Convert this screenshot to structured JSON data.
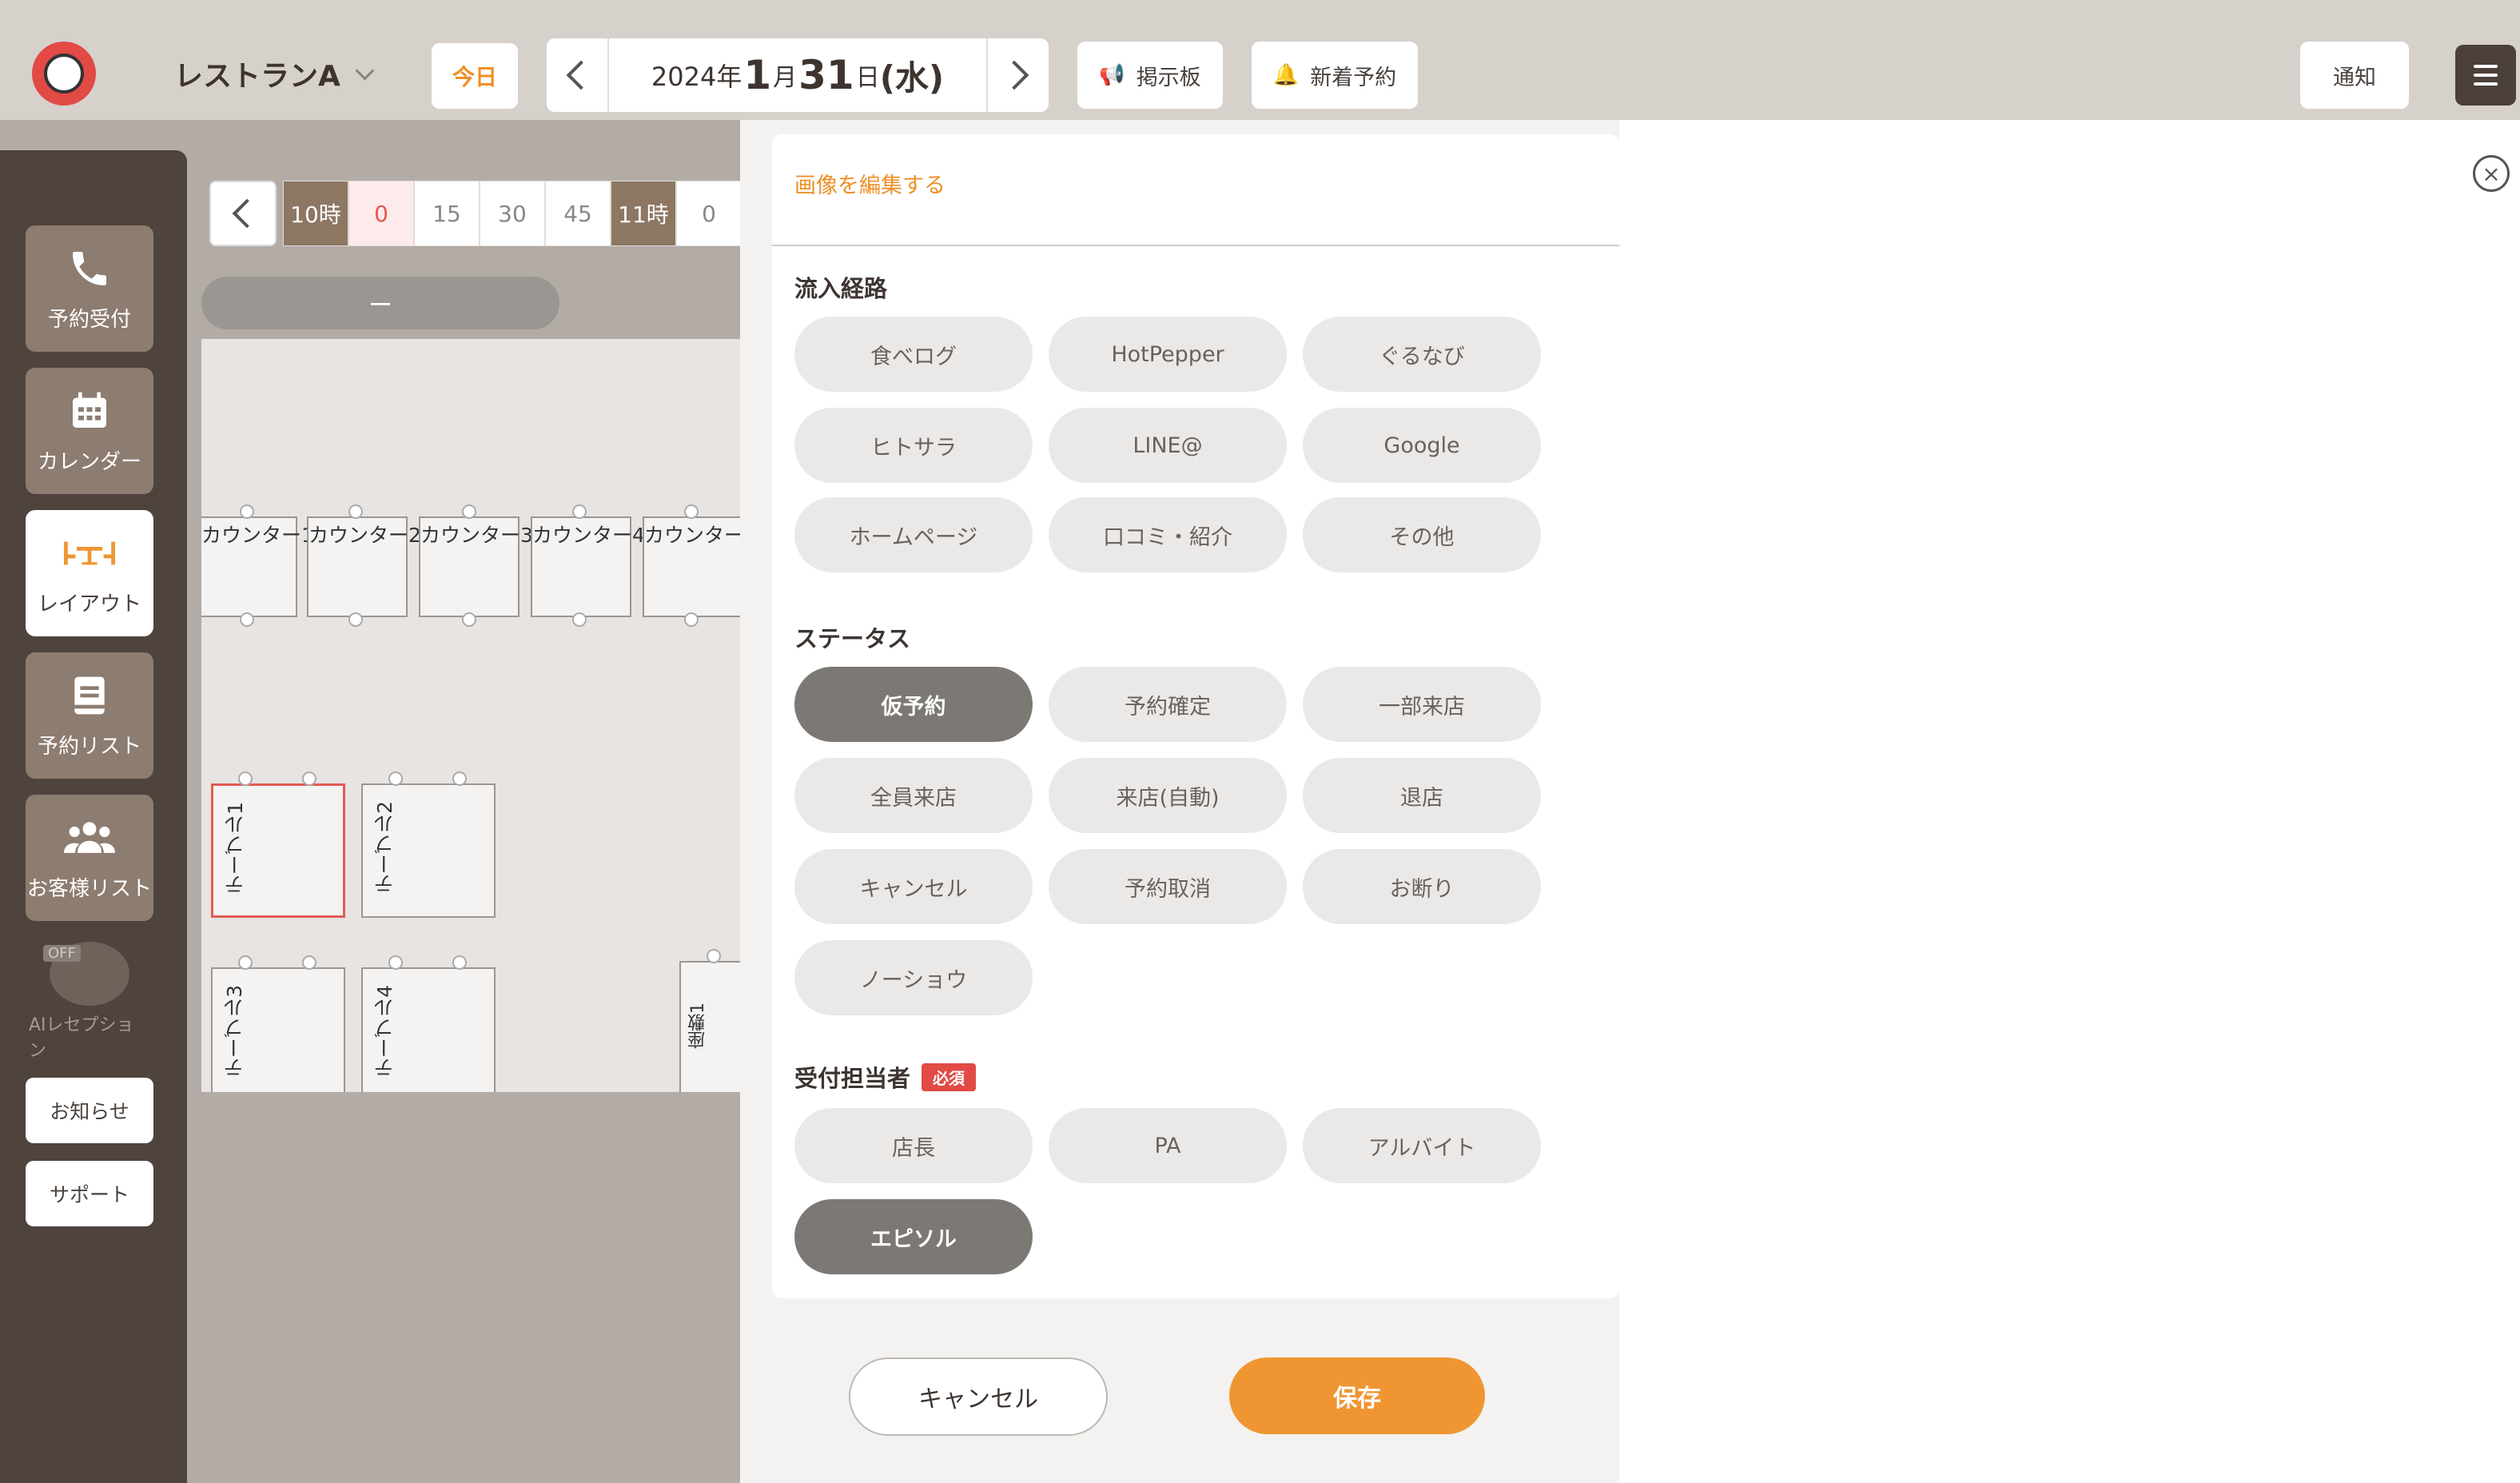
{
  "header": {
    "store_name": "レストランA",
    "today_label": "今日",
    "date": {
      "year": "2024年",
      "month": "1",
      "month_unit": "月",
      "day": "31",
      "day_unit": "日",
      "weekday": "(水)"
    },
    "board_label": "掲示板",
    "new_reservation_label": "新着予約",
    "notice_label": "通知"
  },
  "sidebar": {
    "items": [
      {
        "label": "予約受付",
        "icon": "phone-icon"
      },
      {
        "label": "カレンダー",
        "icon": "calendar-icon"
      },
      {
        "label": "レイアウト",
        "icon": "layout-icon"
      },
      {
        "label": "予約リスト",
        "icon": "book-icon"
      },
      {
        "label": "お客様リスト",
        "icon": "people-icon"
      }
    ],
    "ai_label": "AIレセプション",
    "ai_badge": "OFF",
    "news_label": "お知らせ",
    "support_label": "サポート"
  },
  "timeline": {
    "cells": [
      "10時",
      "0",
      "15",
      "30",
      "45",
      "11時",
      "0"
    ]
  },
  "floor": {
    "pill_label": "ー",
    "counters": [
      "カウンター1",
      "カウンター2",
      "カウンター3",
      "カウンター4",
      "カウンター"
    ],
    "tables": [
      "テーブル1",
      "テーブル2",
      "テーブル3",
      "テーブル4"
    ],
    "zashiki": "座敷1"
  },
  "modal": {
    "edit_image_label": "画像を編集する",
    "source": {
      "title": "流入経路",
      "options": [
        "食べログ",
        "HotPepper",
        "ぐるなび",
        "ヒトサラ",
        "LINE@",
        "Google",
        "ホームページ",
        "口コミ・紹介",
        "その他"
      ]
    },
    "status": {
      "title": "ステータス",
      "options": [
        "仮予約",
        "予約確定",
        "一部来店",
        "全員来店",
        "来店(自動)",
        "退店",
        "キャンセル",
        "予約取消",
        "お断り",
        "ノーショウ"
      ],
      "selected": "仮予約"
    },
    "staff": {
      "title": "受付担当者",
      "required_label": "必須",
      "options": [
        "店長",
        "PA",
        "アルバイト",
        "エピソル"
      ],
      "selected": "エピソル"
    },
    "cancel_label": "キャンセル",
    "save_label": "保存"
  },
  "colors": {
    "accent": "#ef9633",
    "sidebar": "#4f433d",
    "selected_chip": "#7c7874",
    "required": "#e24a45"
  }
}
